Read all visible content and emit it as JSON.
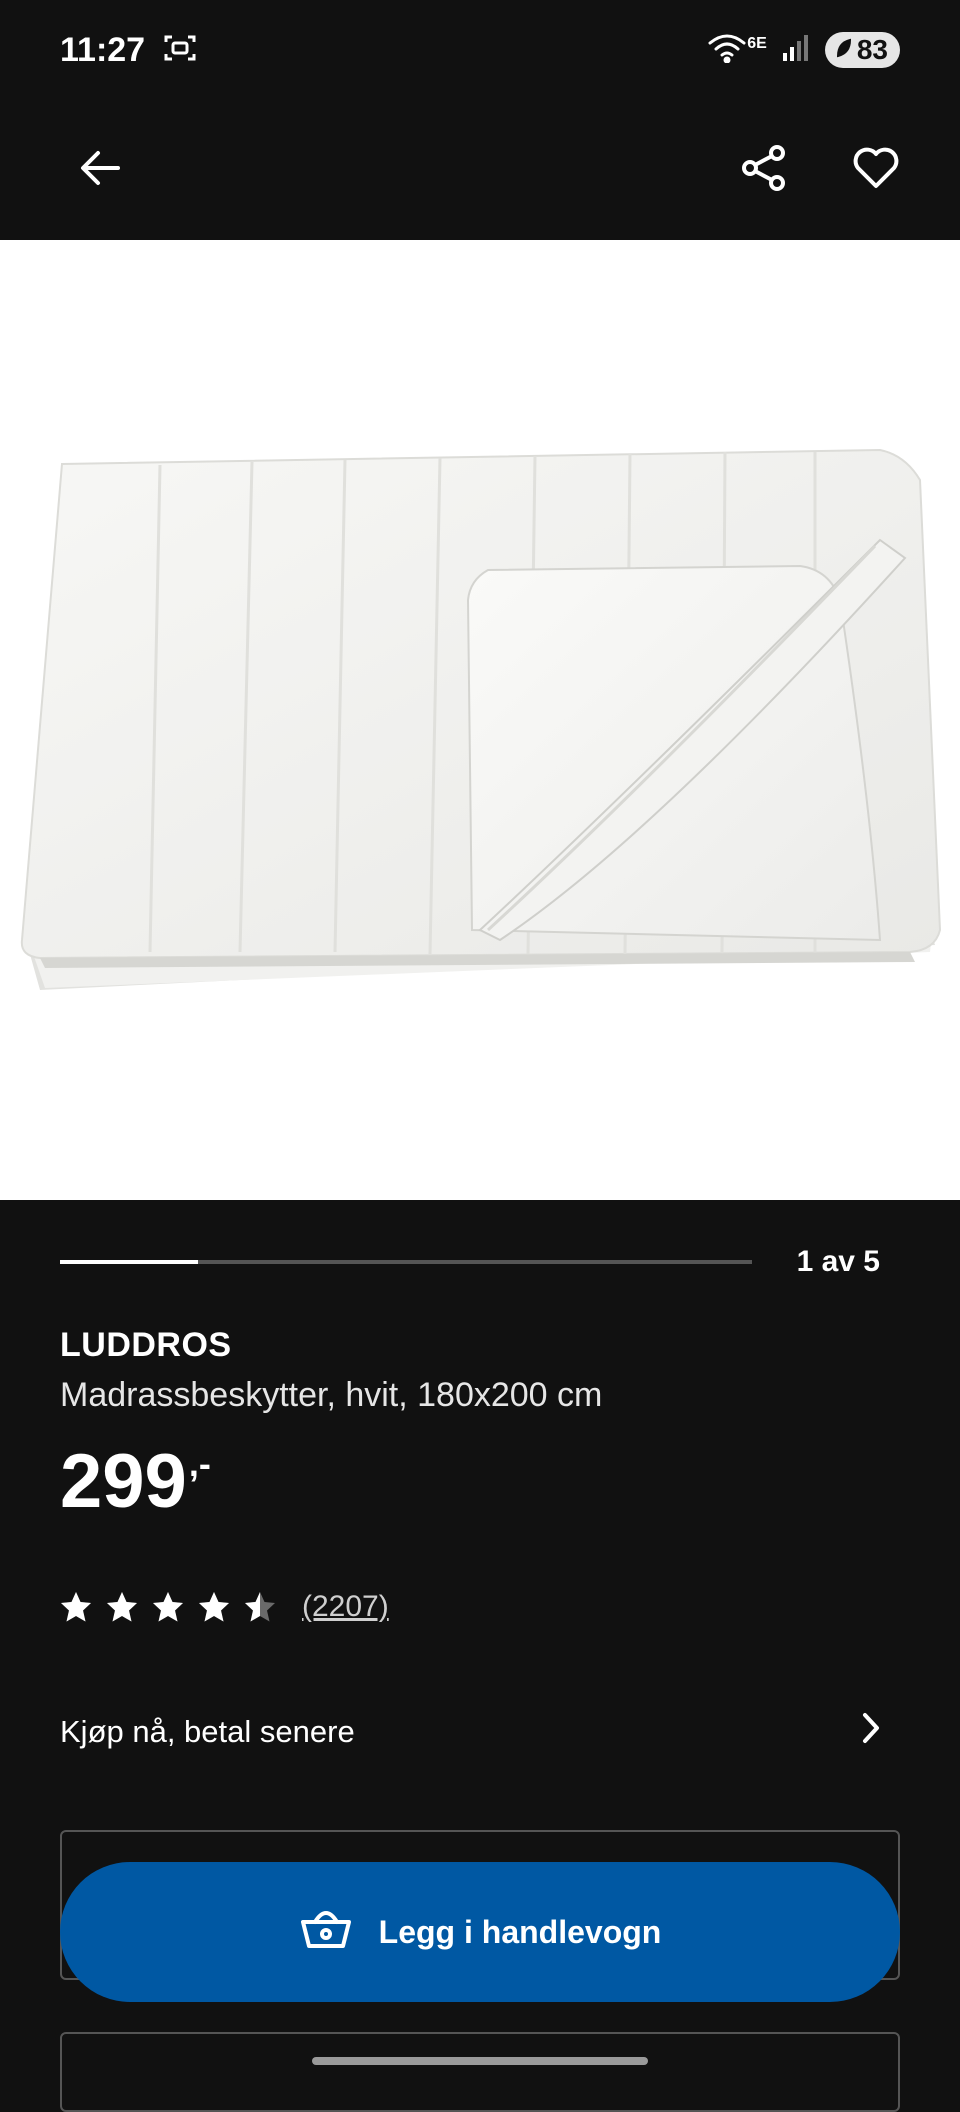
{
  "status_bar": {
    "time": "11:27",
    "network_label": "6E",
    "battery": "83"
  },
  "app_bar": {
    "back_icon": "arrow-left-icon",
    "share_icon": "share-icon",
    "favorite_icon": "heart-outline-icon"
  },
  "gallery": {
    "image_alt": "Madrassbeskytter, hvit",
    "current": 1,
    "total": 5,
    "progress_fraction": 0.2,
    "counter_text": "1 av 5"
  },
  "product": {
    "brand": "LUDDROS",
    "description": "Madrassbeskytter, hvit, 180x200 cm",
    "price": "299",
    "price_suffix": ",-",
    "rating_value": 4.5,
    "rating_max": 5,
    "review_count": "(2207)"
  },
  "bnpl": {
    "label": "Kjøp nå, betal senere",
    "icon": "chevron-right-icon"
  },
  "cta": {
    "label": "Legg i handlevogn",
    "icon": "shopping-basket-icon",
    "color": "#0058a3"
  },
  "colors": {
    "background": "#111111",
    "accent_blue": "#0058a3"
  }
}
